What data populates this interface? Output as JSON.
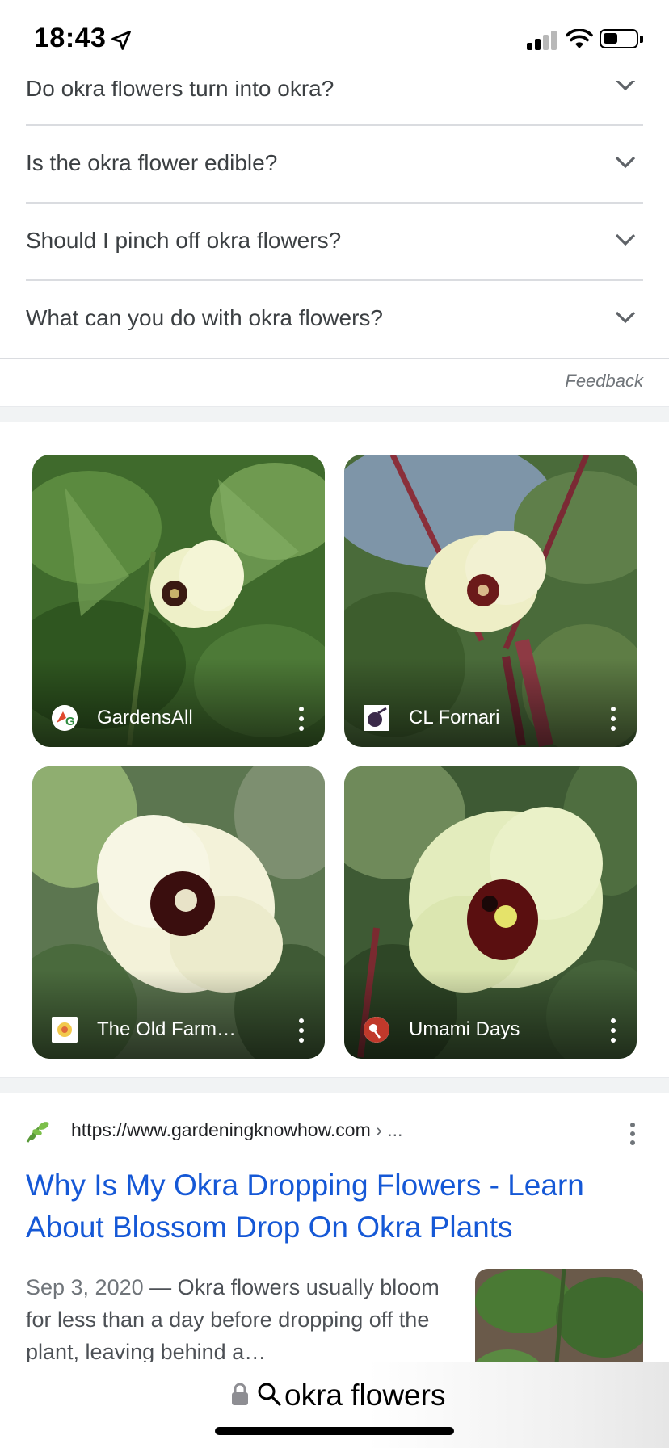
{
  "status_bar": {
    "time": "18:43"
  },
  "paa": {
    "questions": [
      "Do okra flowers turn into okra?",
      "Is the okra flower edible?",
      "Should I pinch off okra flowers?",
      "What can you do with okra flowers?"
    ],
    "feedback_label": "Feedback"
  },
  "images": [
    {
      "source": "GardensAll"
    },
    {
      "source": "CL Fornari"
    },
    {
      "source": "The Old Farm…"
    },
    {
      "source": "Umami Days"
    }
  ],
  "result": {
    "url": "https://www.gardeningknowhow.com",
    "breadcrumb": " › ...",
    "title": "Why Is My Okra Dropping Flowers - Learn About Blossom Drop On Okra Plants",
    "date": "Sep 3, 2020",
    "separator": " — ",
    "snippet": "Okra flowers usually bloom for less than a day before dropping off the plant, leaving behind a…"
  },
  "address_bar": {
    "query": "okra flowers"
  },
  "colors": {
    "link": "#1558d6",
    "divider": "#dadce0"
  }
}
